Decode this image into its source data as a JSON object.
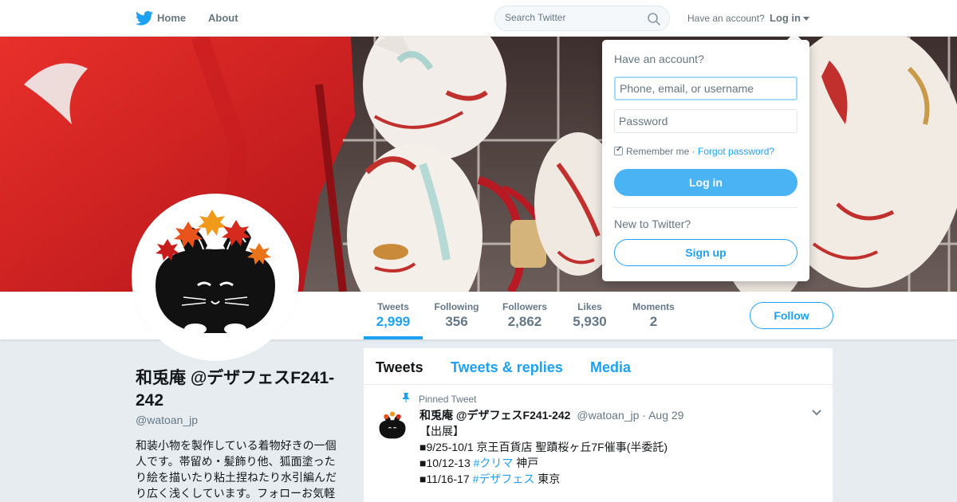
{
  "nav": {
    "home_label": "Home",
    "about_label": "About",
    "search_placeholder": "Search Twitter",
    "have_account": "Have an account?",
    "login_label": "Log in"
  },
  "profile": {
    "name": "和兎庵 @デザフェスF241-242",
    "handle": "@watoan_jp",
    "bio": "和装小物を製作している着物好きの一個人です。帯留め・髪飾り他、狐面塗ったり絵を描いたり粘土捏ねたり水引編んだり広く浅くしています。フォローお気軽"
  },
  "stats": [
    {
      "label": "Tweets",
      "value": "2,999"
    },
    {
      "label": "Following",
      "value": "356"
    },
    {
      "label": "Followers",
      "value": "2,862"
    },
    {
      "label": "Likes",
      "value": "5,930"
    },
    {
      "label": "Moments",
      "value": "2"
    }
  ],
  "follow_label": "Follow",
  "timeline": {
    "tabs": [
      "Tweets",
      "Tweets & replies",
      "Media"
    ],
    "pinned_label": "Pinned Tweet",
    "tweet": {
      "name": "和兎庵 @デザフェスF241-242",
      "handle": "@watoan_jp",
      "time": "· Aug 29",
      "line1": "【出展】",
      "line2": "■9/25-10/1 京王百貨店 聖蹟桜ヶ丘7F催事(半委託)",
      "line3_prefix": "■10/12-13 ",
      "line3_tag": "#クリマ",
      "line3_suffix": " 神戸",
      "line4_prefix": "■11/16-17 ",
      "line4_tag": "#デザフェス",
      "line4_suffix": " 東京"
    }
  },
  "login_dropdown": {
    "heading": "Have an account?",
    "username_placeholder": "Phone, email, or username",
    "password_placeholder": "Password",
    "remember_label": "Remember me",
    "separator": " · ",
    "forgot_label": "Forgot password?",
    "login_button": "Log in",
    "new_label": "New to Twitter?",
    "signup_button": "Sign up"
  },
  "colors": {
    "accent": "#1da1f2",
    "login_button": "#4ab3f4",
    "page_bg": "#e6ecf0"
  }
}
